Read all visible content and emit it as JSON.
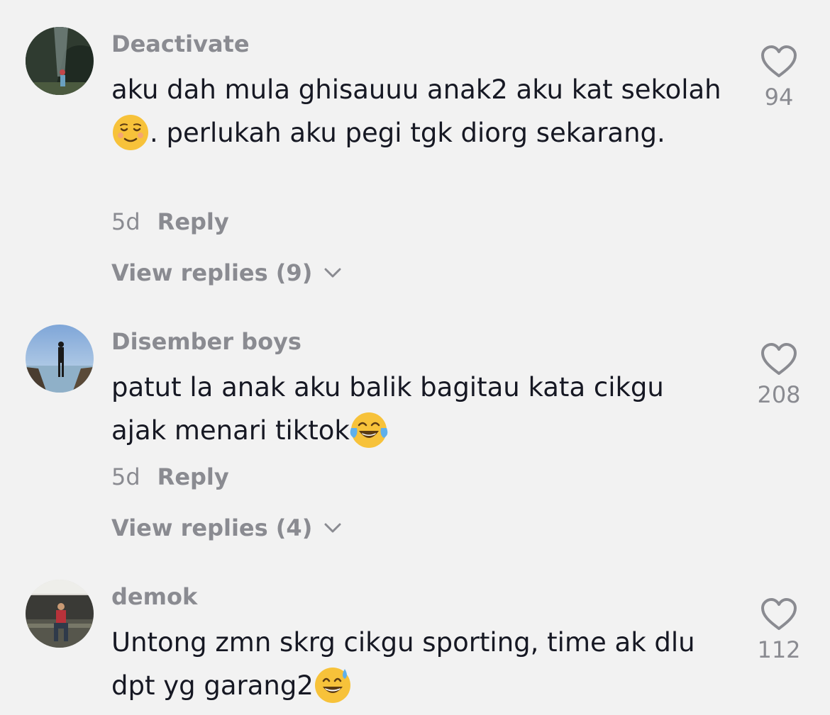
{
  "comments": [
    {
      "username": "Deactivate",
      "text_parts": [
        "aku dah mula ghisauuu anak2 aku kat sekolah",
        ". perlukah aku pegi tgk diorg sekarang."
      ],
      "emoji": "relieved-face",
      "age": "5d",
      "reply_label": "Reply",
      "view_replies": "View replies (9)",
      "likes": "94"
    },
    {
      "username": "Disember boys",
      "text_parts": [
        "patut la anak aku balik bagitau kata cikgu ajak menari tiktok",
        ""
      ],
      "emoji": "tears-of-joy-face",
      "age": "5d",
      "reply_label": "Reply",
      "view_replies": "View replies (4)",
      "likes": "208"
    },
    {
      "username": "demok",
      "text_parts": [
        "Untong zmn skrg cikgu sporting, time ak dlu dpt yg garang2",
        ""
      ],
      "emoji": "grinning-sweat-face",
      "likes": "112"
    }
  ],
  "icons": {
    "like": "heart-outline-icon",
    "expand": "chevron-down-icon"
  },
  "colors": {
    "background": "#f2f2f2",
    "text": "#161823",
    "secondary": "#8a8b91",
    "emoji_yellow": "#f7c23a"
  }
}
